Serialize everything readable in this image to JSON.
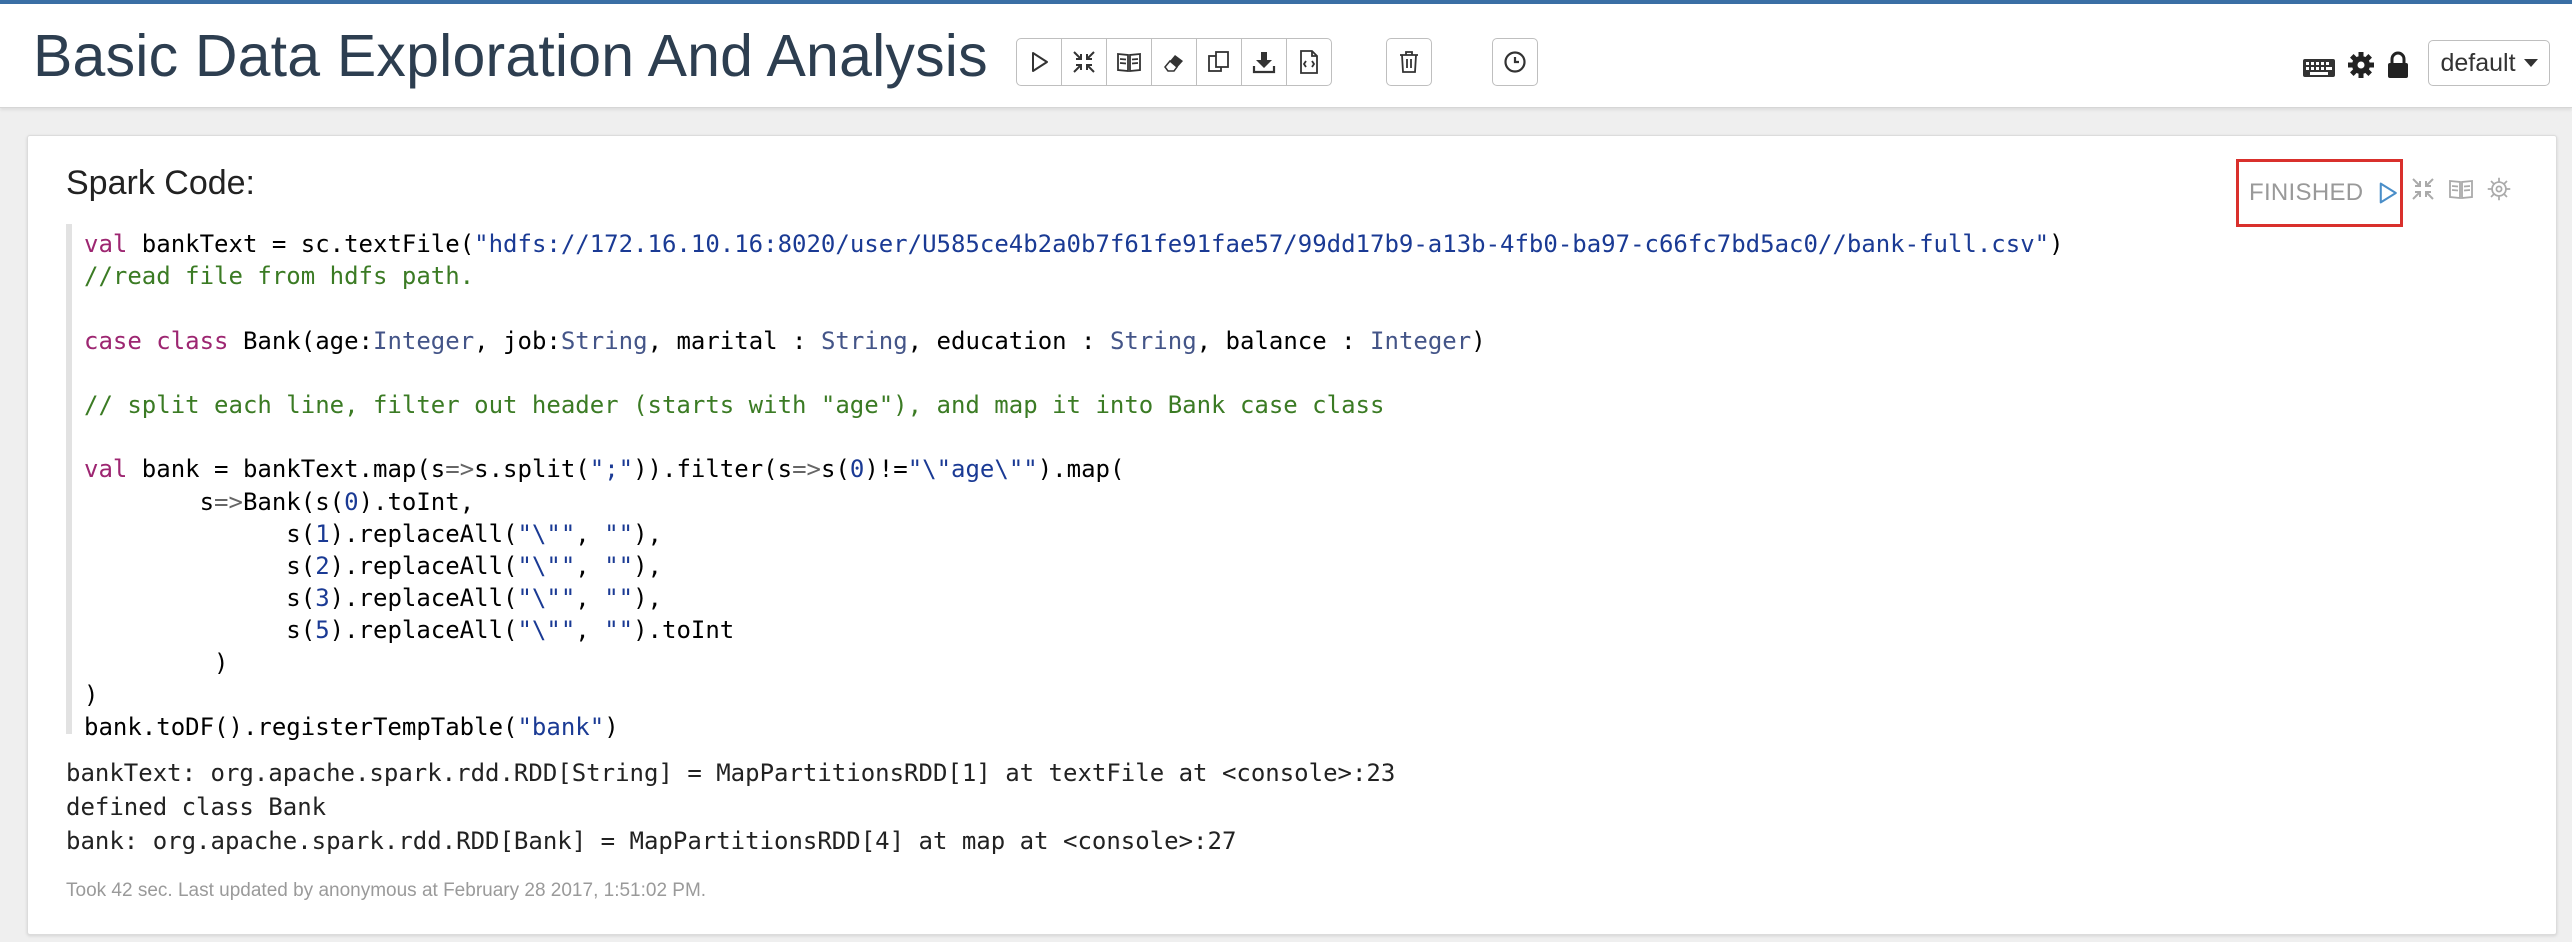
{
  "notebook": {
    "title": "Basic Data Exploration And Analysis",
    "interpreter_label": "default"
  },
  "toolbar": {
    "buttons": [
      {
        "icon": "run-all-icon"
      },
      {
        "icon": "collapse-icon"
      },
      {
        "icon": "book-icon"
      },
      {
        "icon": "eraser-icon"
      },
      {
        "icon": "copy-icon"
      },
      {
        "icon": "download-icon"
      },
      {
        "icon": "export-icon"
      },
      {
        "icon": "trash-icon"
      },
      {
        "icon": "clock-icon"
      }
    ],
    "right_icons": [
      "keyboard-icon",
      "gear-icon",
      "lock-icon"
    ]
  },
  "paragraph": {
    "title": "Spark Code:",
    "status": "FINISHED",
    "status_color": "#d9302c",
    "code_lines": [
      "val bankText = sc.textFile(\"hdfs://172.16.10.16:8020/user/U585ce4b2a0b7f61fe91fae57/99dd17b9-a13b-4fb0-ba97-c66fc7bd5ac0//bank-full.csv\")",
      "//read file from hdfs path.",
      "",
      "case class Bank(age:Integer, job:String, marital : String, education : String, balance : Integer)",
      "",
      "// split each line, filter out header (starts with \"age\"), and map it into Bank case class",
      "",
      "val bank = bankText.map(s=>s.split(\";\")).filter(s=>s(0)!=\"\\\"age\\\"\").map(",
      "        s=>Bank(s(0).toInt,",
      "              s(1).replaceAll(\"\\\"\", \"\"),",
      "              s(2).replaceAll(\"\\\"\", \"\"),",
      "              s(3).replaceAll(\"\\\"\", \"\"),",
      "              s(5).replaceAll(\"\\\"\", \"\").toInt",
      "         )",
      ")",
      "bank.toDF().registerTempTable(\"bank\")"
    ],
    "output_lines": [
      "bankText: org.apache.spark.rdd.RDD[String] = MapPartitionsRDD[1] at textFile at <console>:23",
      "defined class Bank",
      "bank: org.apache.spark.rdd.RDD[Bank] = MapPartitionsRDD[4] at map at <console>:27"
    ],
    "footer": "Took 42 sec. Last updated by anonymous at February 28 2017, 1:51:02 PM."
  }
}
